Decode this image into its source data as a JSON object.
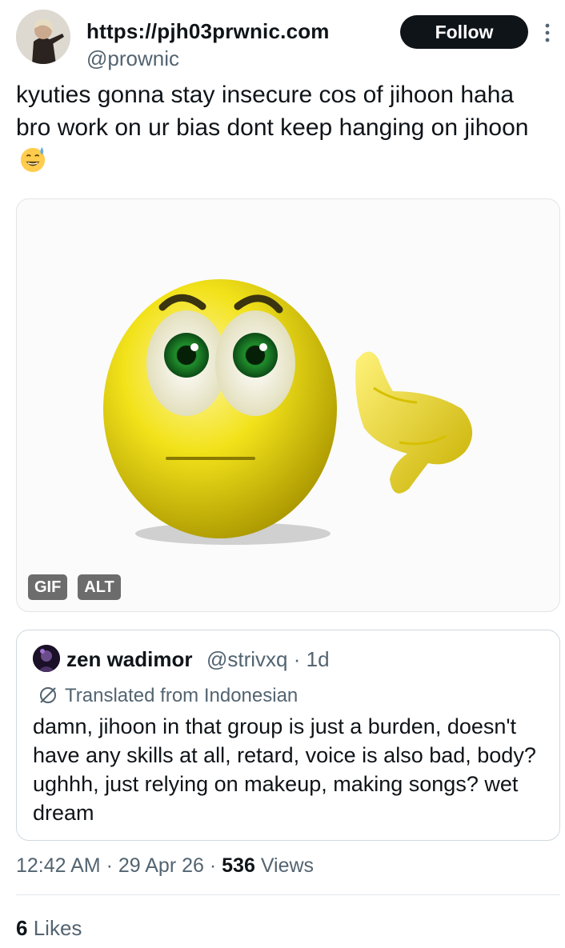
{
  "author": {
    "display_name": "https://pjh03prwnic.com",
    "handle": "@prownic",
    "avatar_icon": "user-avatar"
  },
  "follow_label": "Follow",
  "more_icon": "more-vertical-icon",
  "tweet": {
    "text": "kyuties gonna stay insecure cos of jihoon haha bro work on ur bias dont keep hanging on jihoon",
    "emoji": "grinning-face-with-sweat"
  },
  "media": {
    "type": "gif",
    "gif_badge": "GIF",
    "alt_badge": "ALT"
  },
  "quote": {
    "display_name": "zen wadimor",
    "handle": "@strivxq",
    "separator": "·",
    "age": "1d",
    "translated_label": "Translated from Indonesian",
    "text": "damn, jihoon in that group is just a burden, doesn't have any skills at all, retard, voice is also bad, body? ughhh, just relying on makeup, making songs? wet dream"
  },
  "stats": {
    "time": "12:42 AM",
    "date": "29 Apr 26",
    "views_count": "536",
    "views_label": "Views",
    "likes_count": "6",
    "likes_label": "Likes",
    "dot": "·"
  },
  "colors": {
    "text_primary": "#0f1419",
    "text_secondary": "#536471",
    "border": "#cfd9de",
    "button_bg": "#0f1419"
  }
}
